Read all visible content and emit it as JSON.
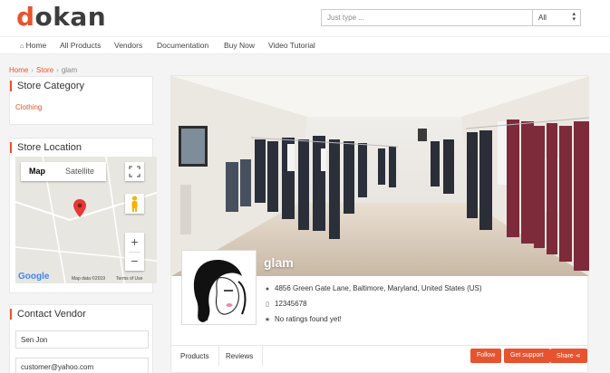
{
  "brand": {
    "logo_first": "d",
    "logo_rest": "okan"
  },
  "search": {
    "placeholder": "Just type ...",
    "category": "All"
  },
  "nav": {
    "home": "Home",
    "all_products": "All Products",
    "vendors": "Vendors",
    "documentation": "Documentation",
    "buy_now": "Buy Now",
    "video_tutorial": "Video Tutorial"
  },
  "breadcrumb": {
    "home": "Home",
    "store": "Store",
    "current": "glam",
    "separator": "›"
  },
  "sidebar": {
    "category": {
      "title": "Store Category",
      "items": [
        "Clothing"
      ]
    },
    "location": {
      "title": "Store Location",
      "map_tab": "Map",
      "satellite_tab": "Satellite",
      "google": "Google",
      "map_data": "Map data ©2019",
      "terms": "Terms of Use",
      "zoom_in": "+",
      "zoom_out": "−"
    },
    "contact": {
      "title": "Contact Vendor",
      "name": "Sen Jon",
      "email": "customer@yahoo.com"
    }
  },
  "store": {
    "name": "glam",
    "address": "4856 Green Gate Lane, Baltimore, Maryland, United States (US)",
    "phone": "12345678",
    "rating": "No ratings found yet!",
    "tabs": [
      "Products",
      "Reviews"
    ],
    "buttons": {
      "follow": "Follow",
      "support": "Get support",
      "share": "Share"
    }
  },
  "colors": {
    "accent": "#e8532f"
  }
}
